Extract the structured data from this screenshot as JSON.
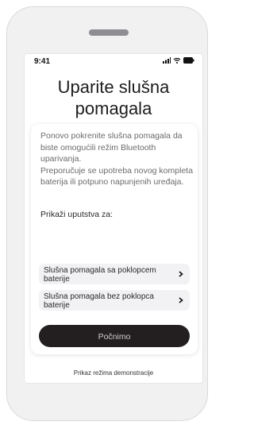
{
  "status": {
    "time": "9:41",
    "icons": [
      "signal-icon",
      "wifi-icon",
      "battery-icon"
    ]
  },
  "title": "Uparite slušna pomagala",
  "body": {
    "paragraph1": "Ponovo pokrenite slušna pomagala da biste omogućili režim Bluetooth uparivanja.",
    "paragraph2": "Preporučuje se upotreba novog kompleta baterija ili potpuno napunjenih uređaja."
  },
  "instructions_label": "Prikaži uputstva za:",
  "options": [
    {
      "label": "Slušna pomagala sa poklopcem baterije",
      "icon": "chevron-right-icon"
    },
    {
      "label": "Slušna pomagala bez poklopca baterije",
      "icon": "chevron-right-icon"
    }
  ],
  "start_button": "Počnimo",
  "demo_link": "Prikaz režima demonstracije",
  "colors": {
    "primary_button": "#231f20",
    "device_frame": "#f1f1f2"
  }
}
